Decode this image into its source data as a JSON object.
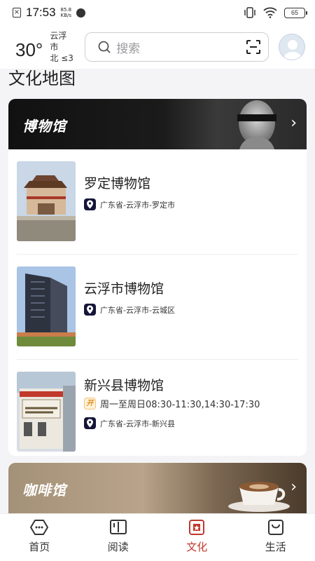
{
  "status_bar": {
    "time": "17:53",
    "speed_value": "85.8",
    "speed_unit": "KB/s",
    "battery": "65"
  },
  "header": {
    "temperature": "30°",
    "city": "云浮市",
    "wind": "北 ≤3",
    "search_placeholder": "搜索",
    "icons": [
      "search-icon",
      "scan-icon",
      "avatar"
    ]
  },
  "page": {
    "title": "文化地图"
  },
  "museum_section": {
    "title": "博物馆",
    "items": [
      {
        "name": "罗定博物馆",
        "address": "广东省-云浮市-罗定市"
      },
      {
        "name": "云浮市博物馆",
        "address": "广东省-云浮市-云城区"
      },
      {
        "name": "新兴县博物馆",
        "hours_badge": "开",
        "hours": "周一至周日08:30-11:30,14:30-17:30",
        "address": "广东省-云浮市-新兴县"
      }
    ]
  },
  "cafe_section": {
    "title": "咖啡馆"
  },
  "tabs": [
    {
      "label": "首页",
      "icon": "home-icon",
      "active": false
    },
    {
      "label": "阅读",
      "icon": "book-icon",
      "active": false
    },
    {
      "label": "文化",
      "icon": "culture-icon",
      "active": true
    },
    {
      "label": "生活",
      "icon": "life-bag-icon",
      "active": false
    }
  ],
  "colors": {
    "accent": "#c0392b",
    "pin_bg": "#16163a",
    "background": "#f4f4f6"
  }
}
